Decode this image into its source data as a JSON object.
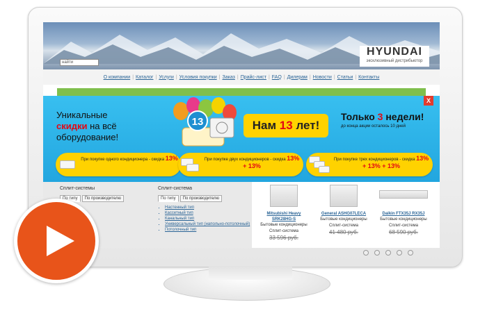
{
  "search": {
    "placeholder": "найти"
  },
  "logo": {
    "name": "HYUNDAI",
    "subtitle": "эксклюзивный дистрибьютор"
  },
  "nav": [
    "О компании",
    "Каталог",
    "Услуги",
    "Условия покупки",
    "Заказ",
    "Прайс-лист",
    "FAQ",
    "Дилерам",
    "Новости",
    "Статьи",
    "Контакты"
  ],
  "banner": {
    "close_label": "X",
    "tagline": {
      "line1": "Уникальные",
      "red": "скидки",
      "line2_rest": " на всё",
      "line3": "оборудование!"
    },
    "badge_number": "13",
    "years": {
      "pre": "Нам ",
      "num": "13",
      "post": " лет!"
    },
    "weeks": {
      "pre": "Только ",
      "num": "3",
      "post": " недели!"
    },
    "until": "до конца акции осталось 10 дней",
    "offers": [
      {
        "text": "При покупке одного кондиционера - скидка",
        "pct": "13%"
      },
      {
        "text": "При покупке двух кондиционеров - скидка",
        "pct": "13% + 13%"
      },
      {
        "text": "При покупке трех кондиционеров - скидка",
        "pct": "13% + 13% + 13%"
      }
    ]
  },
  "content": {
    "col1": {
      "title": "Сплит-системы",
      "tab1": "По типу",
      "tab2": "По производителю"
    },
    "col2": {
      "title": "Сплит-система",
      "tab1": "По типу",
      "tab2": "По производителю",
      "items": [
        "Настенный тип",
        "Кассетный тип",
        "Канальный тип",
        "Универсальный тип (напольно-потолочный)",
        "Потолочный тип"
      ]
    },
    "products": [
      {
        "name": "Mitsubishi Heavy SRK28HG-S",
        "type": "Бытовые кондиционеры",
        "cat": "Сплит-система",
        "price": "33 596 руб."
      },
      {
        "name": "General ASHG07LECA",
        "type": "Бытовые кондиционеры",
        "cat": "Сплит-система",
        "price": "41 480 руб."
      },
      {
        "name": "Daikin FTX35J RX35J",
        "type": "Бытовые кондиционеры",
        "cat": "Сплит-система",
        "price": "68 590 руб."
      }
    ]
  },
  "colors": {
    "accent": "#e8541a",
    "banner": "#2bb3e8",
    "yellow": "#ffd200",
    "red": "#e30613"
  },
  "icons": [
    "play-icon",
    "close-icon",
    "air-conditioner-icon"
  ]
}
